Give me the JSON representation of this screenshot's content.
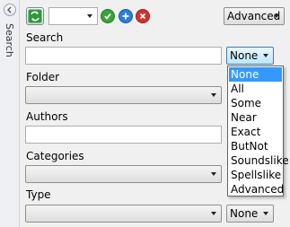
{
  "side": {
    "label": "Search"
  },
  "toolbar": {
    "mode_value": "Advanced",
    "combo_value": ""
  },
  "fields": {
    "search_label": "Search",
    "search_value": "",
    "search_match": "None",
    "folder_label": "Folder",
    "authors_label": "Authors",
    "authors_value": "",
    "categories_label": "Categories",
    "type_label": "Type",
    "type_match": "None"
  },
  "match_options": [
    "None",
    "All",
    "Some",
    "Near",
    "Exact",
    "ButNot",
    "Soundslike",
    "Spellslike",
    "Advanced"
  ],
  "colors": {
    "accent": "#3399ff",
    "refresh_green": "#2e9a3b",
    "ok_green": "#3aa33a",
    "add_blue": "#2b7ed8",
    "close_red": "#d43131"
  }
}
